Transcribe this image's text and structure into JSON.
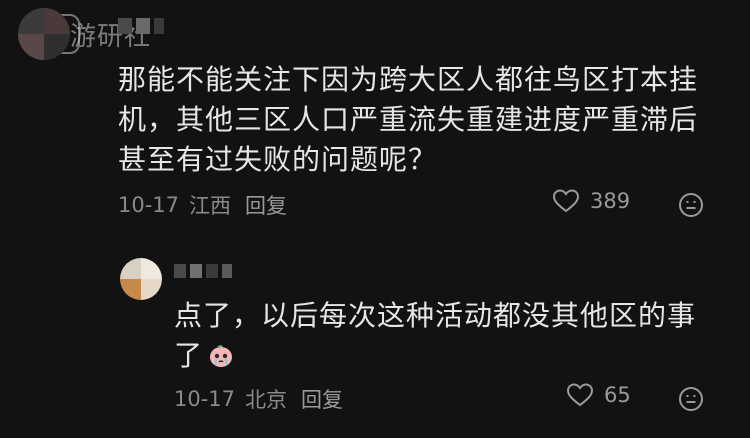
{
  "watermark": {
    "text": "游研社"
  },
  "comments": [
    {
      "text_lines": [
        "那能不能关注下因为跨大区人都往鸟区打本挂",
        "机，其他三区人口严重流失重建进度严重滞后",
        "甚至有过失败的问题呢？"
      ],
      "date": "10-17",
      "location": "江西",
      "reply_label": "回复",
      "likes": "389",
      "icons": {
        "like": "heart-outline-icon",
        "emoji": "emoji-face-icon"
      }
    },
    {
      "text_lines": [
        "点了，以后每次这种活动都没其他区的事",
        "了"
      ],
      "date": "10-17",
      "location": "北京",
      "reply_label": "回复",
      "likes": "65",
      "icons": {
        "like": "heart-outline-icon",
        "emoji": "emoji-face-icon",
        "sticker": "crying-peach-sticker"
      }
    }
  ],
  "colors": {
    "background": "#121212",
    "text": "#e6e6e6",
    "meta": "#8a8a8a"
  }
}
